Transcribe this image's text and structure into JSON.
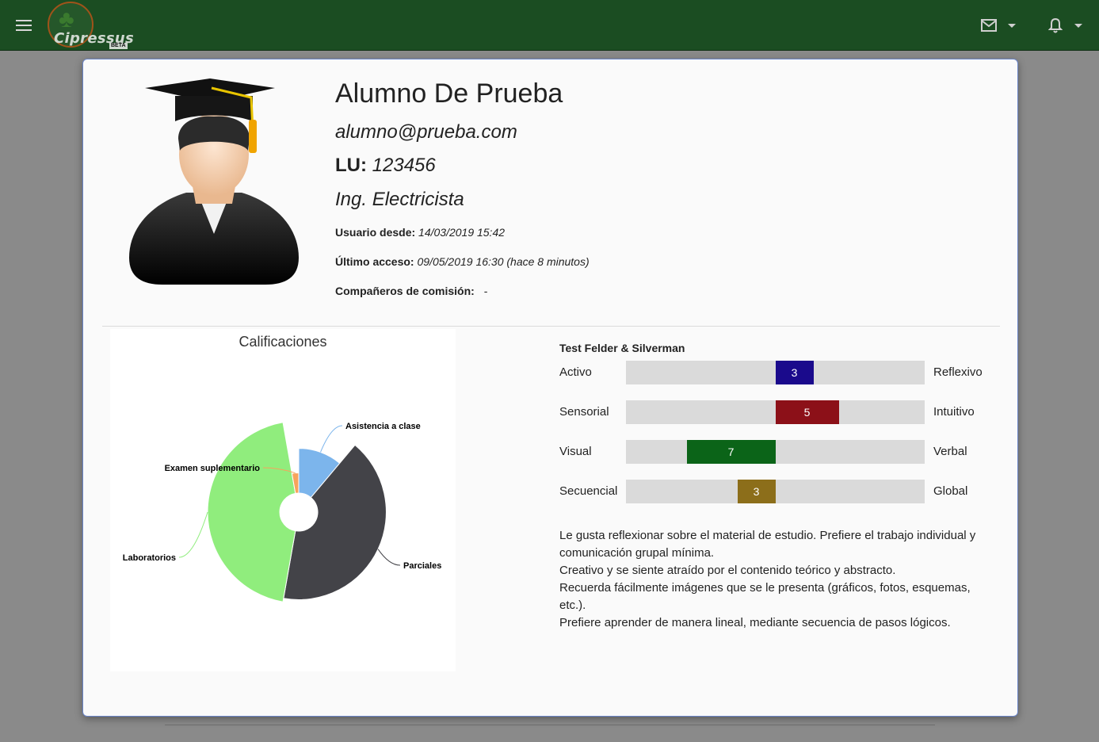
{
  "topbar": {
    "logo_text": "Cipressus",
    "logo_badge": "BETA",
    "bg_color": "#1b4d22"
  },
  "profile": {
    "name": "Alumno De Prueba",
    "email": "alumno@prueba.com",
    "lu_label": "LU:",
    "lu_value": "123456",
    "career": "Ing. Electricista",
    "user_since_label": "Usuario desde:",
    "user_since_value": "14/03/2019 15:42",
    "last_access_label": "Último acceso:",
    "last_access_value": "09/05/2019 16:30 (hace 8 minutos)",
    "classmates_label": "Compañeros de comisión:",
    "classmates_value": "-"
  },
  "chart_data": {
    "type": "pie",
    "title": "Calificaciones",
    "variant": "rose-donut",
    "slices": [
      {
        "name": "Asistencia a clase",
        "angle_deg": 40,
        "radius_level": 0.62,
        "color": "#7cb5ec"
      },
      {
        "name": "Parciales",
        "angle_deg": 150,
        "radius_level": 0.95,
        "color": "#434348"
      },
      {
        "name": "Laboratorios",
        "angle_deg": 160,
        "radius_level": 1.0,
        "color": "#90ed7d"
      },
      {
        "name": "Examen suplementario",
        "angle_deg": 10,
        "radius_level": 0.28,
        "color": "#f7a35c"
      }
    ]
  },
  "felder": {
    "title": "Test Felder & Silverman",
    "rows": [
      {
        "left": "Activo",
        "right": "Reflexivo",
        "value": "3",
        "side": "right",
        "color": "#1a0a8c"
      },
      {
        "left": "Sensorial",
        "right": "Intuitivo",
        "value": "5",
        "side": "right",
        "color": "#8c1018"
      },
      {
        "left": "Visual",
        "right": "Verbal",
        "value": "7",
        "side": "left",
        "color": "#0b6418"
      },
      {
        "left": "Secuencial",
        "right": "Global",
        "value": "3",
        "side": "left",
        "color": "#8c6e1a"
      }
    ],
    "descriptions": [
      "Le gusta reflexionar sobre el material de estudio. Prefiere el trabajo individual y comunicación grupal mínima.",
      "Creativo y se siente atraído por el contenido teórico y abstracto.",
      "Recuerda fácilmente imágenes que se le presenta (gráficos, fotos, esquemas, etc.).",
      "Prefiere aprender de manera lineal, mediante secuencia de pasos lógicos."
    ]
  },
  "icons": {
    "menu": "menu-icon",
    "mail": "mail-icon",
    "bell": "bell-icon"
  }
}
